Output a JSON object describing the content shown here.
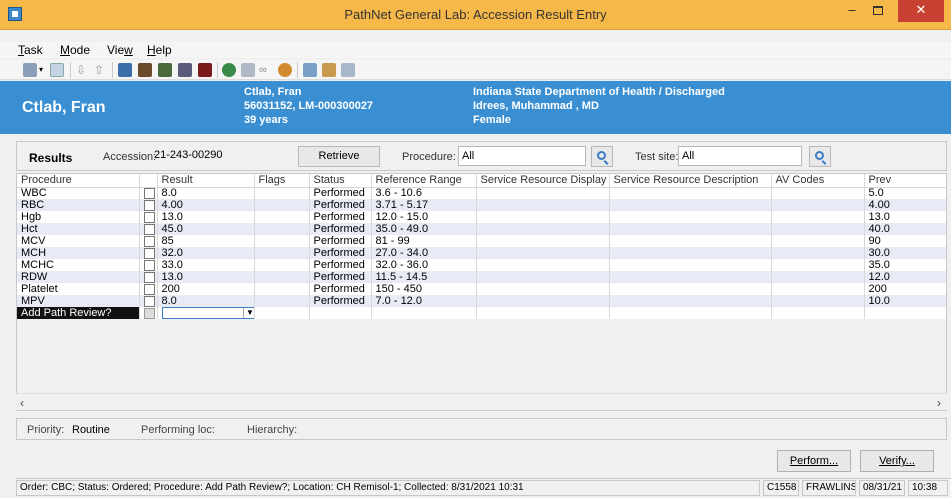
{
  "window": {
    "title": "PathNet General Lab: Accession Result Entry",
    "min_label": "–",
    "close_label": "✕"
  },
  "menu": [
    {
      "label": "Task",
      "access": "T",
      "rest": "ask"
    },
    {
      "label": "Mode",
      "access": "M",
      "rest": "ode"
    },
    {
      "label": "View",
      "pre": "Vie",
      "access": "w"
    },
    {
      "label": "Help",
      "access": "H",
      "rest": "elp"
    }
  ],
  "toolbar_icons": [
    "printer-icon",
    "dropdown-arrow-icon",
    "document-icon",
    "arrow-down-icon",
    "arrow-up-icon",
    "lab-icon",
    "flowsheet-icon",
    "results-icon",
    "list-icon",
    "stop-icon",
    "globe-icon",
    "comment-icon",
    "link-icon",
    "person-icon",
    "chart-icon",
    "copy-icon",
    "grid-icon"
  ],
  "colors": {
    "titlebar": "#f7b84a",
    "banner": "#3a8fd3",
    "close": "#c84031",
    "alt_row": "#e8eaf6"
  },
  "patient": {
    "name": "Ctlab, Fran",
    "name_small": "Ctlab, Fran",
    "ids": "56031152, LM-000300027",
    "age": "39 years",
    "facility": "Indiana State Department of Health / Discharged",
    "physician": "Idrees, Muhammad , MD",
    "sex": "Female"
  },
  "results_bar": {
    "title": "Results",
    "accession_label_pre": "Accession:",
    "accession_value": "21-243-00290",
    "retrieve_label": "Retrieve",
    "procedure_label": "Procedure:",
    "procedure_value": "All",
    "testsite_label": "Test site:",
    "testsite_value": "All"
  },
  "grid": {
    "columns": [
      "Procedure",
      "",
      "Result",
      "Flags",
      "Status",
      "Reference Range",
      "Service Resource Display",
      "Service Resource Description",
      "AV Codes",
      "Prev"
    ],
    "rows": [
      {
        "procedure": "WBC",
        "result": "8.0",
        "flags": "",
        "status": "Performed",
        "range": "3.6 - 10.6",
        "prev": "5.0"
      },
      {
        "procedure": "RBC",
        "result": "4.00",
        "flags": "",
        "status": "Performed",
        "range": "3.71 - 5.17",
        "prev": "4.00"
      },
      {
        "procedure": "Hgb",
        "result": "13.0",
        "flags": "",
        "status": "Performed",
        "range": "12.0 - 15.0",
        "prev": "13.0"
      },
      {
        "procedure": "Hct",
        "result": "45.0",
        "flags": "",
        "status": "Performed",
        "range": "35.0 - 49.0",
        "prev": "40.0"
      },
      {
        "procedure": "MCV",
        "result": "85",
        "flags": "",
        "status": "Performed",
        "range": "81 - 99",
        "prev": "90"
      },
      {
        "procedure": "MCH",
        "result": "32.0",
        "flags": "",
        "status": "Performed",
        "range": "27.0 - 34.0",
        "prev": "30.0"
      },
      {
        "procedure": "MCHC",
        "result": "33.0",
        "flags": "",
        "status": "Performed",
        "range": "32.0 - 36.0",
        "prev": "35.0"
      },
      {
        "procedure": "RDW",
        "result": "13.0",
        "flags": "",
        "status": "Performed",
        "range": "11.5 - 14.5",
        "prev": "12.0"
      },
      {
        "procedure": "Platelet",
        "result": "200",
        "flags": "",
        "status": "Performed",
        "range": "150 - 450",
        "prev": "200"
      },
      {
        "procedure": "MPV",
        "result": "8.0",
        "flags": "",
        "status": "Performed",
        "range": "7.0 - 12.0",
        "prev": "10.0"
      }
    ],
    "selected_row": {
      "procedure": "Add Path Review?",
      "result": ""
    }
  },
  "info": {
    "priority_label": "Priority:",
    "priority_value": "Routine",
    "performing_label": "Performing loc:",
    "hierarchy_label": "Hierarchy:"
  },
  "actions": {
    "perform_label": "Perform...",
    "verify_label": "Verify..."
  },
  "status": {
    "message": "Order: CBC; Status: Ordered; Procedure: Add Path Review?; Location: CH Remisol-1; Collected: 8/31/2021 10:31",
    "station": "C1558",
    "user": "FRAWLINS",
    "date": "08/31/21",
    "time": "10:38"
  }
}
